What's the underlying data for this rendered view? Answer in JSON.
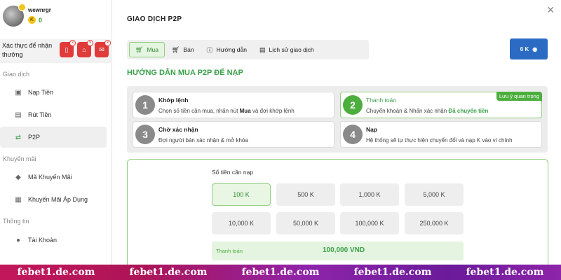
{
  "profile": {
    "username": "wewnrgr",
    "coin_symbol": "K",
    "balance": "0"
  },
  "verify": {
    "text": "Xác thực để nhận thưởng"
  },
  "sidebar": {
    "section_transactions": "Giao dịch",
    "section_promotions": "Khuyến mãi",
    "section_info": "Thông tin",
    "items": [
      {
        "label": "Nạp Tiền",
        "icon": "deposit-icon"
      },
      {
        "label": "Rút Tiền",
        "icon": "withdraw-icon"
      },
      {
        "label": "P2P",
        "icon": "p2p-icon",
        "active": true
      },
      {
        "label": "Mã Khuyến Mãi",
        "icon": "promo-code-icon"
      },
      {
        "label": "Khuyến Mãi Áp Dụng",
        "icon": "applied-promo-icon"
      },
      {
        "label": "Tài Khoản",
        "icon": "account-icon"
      }
    ]
  },
  "main": {
    "title": "GIAO DỊCH P2P",
    "tabs": [
      {
        "label": "Mua",
        "icon": "cart-icon",
        "active": true
      },
      {
        "label": "Bán",
        "icon": "sell-cart-icon"
      },
      {
        "label": "Hướng dẫn",
        "icon": "help-icon"
      },
      {
        "label": "Lịch sử giao dịch",
        "icon": "history-icon"
      }
    ],
    "balance_button": "0 K",
    "guide_title": "HƯỚNG DẪN MUA P2P ĐỂ NẠP",
    "steps": [
      {
        "num": "1",
        "title": "Khớp lệnh",
        "desc_pre": "Chọn số tiền cần mua, nhấn nút ",
        "desc_bold": "Mua",
        "desc_post": " và đợi khớp lệnh"
      },
      {
        "num": "2",
        "title": "Thanh toán",
        "desc_pre": "Chuyển khoản & Nhấn xác nhận ",
        "desc_bold": "Đã chuyển tiền",
        "desc_post": "",
        "badge": "Lưu ý quan trọng"
      },
      {
        "num": "3",
        "title": "Chờ xác nhận",
        "desc_pre": "Đợi người bán xác nhận & mở khóa",
        "desc_bold": "",
        "desc_post": ""
      },
      {
        "num": "4",
        "title": "Nạp",
        "desc_pre": "Hệ thống sẽ tự thực hiện chuyển đổi và nạp K vào ví chính",
        "desc_bold": "",
        "desc_post": ""
      }
    ],
    "amount_label": "Số tiền cần nạp",
    "amounts": [
      "100 K",
      "500 K",
      "1,000 K",
      "5,000 K",
      "10,000 K",
      "50,000 K",
      "100,000 K",
      "250,000 K"
    ],
    "selected_amount": "100 K",
    "payment_label": "Thanh toán",
    "payment_value": "100,000 VND"
  },
  "watermark": {
    "text": "febet1.de.com"
  },
  "colors": {
    "accent_green": "#3aa14a",
    "button_blue": "#2b6bc4",
    "alert_red": "#e03a3a"
  }
}
